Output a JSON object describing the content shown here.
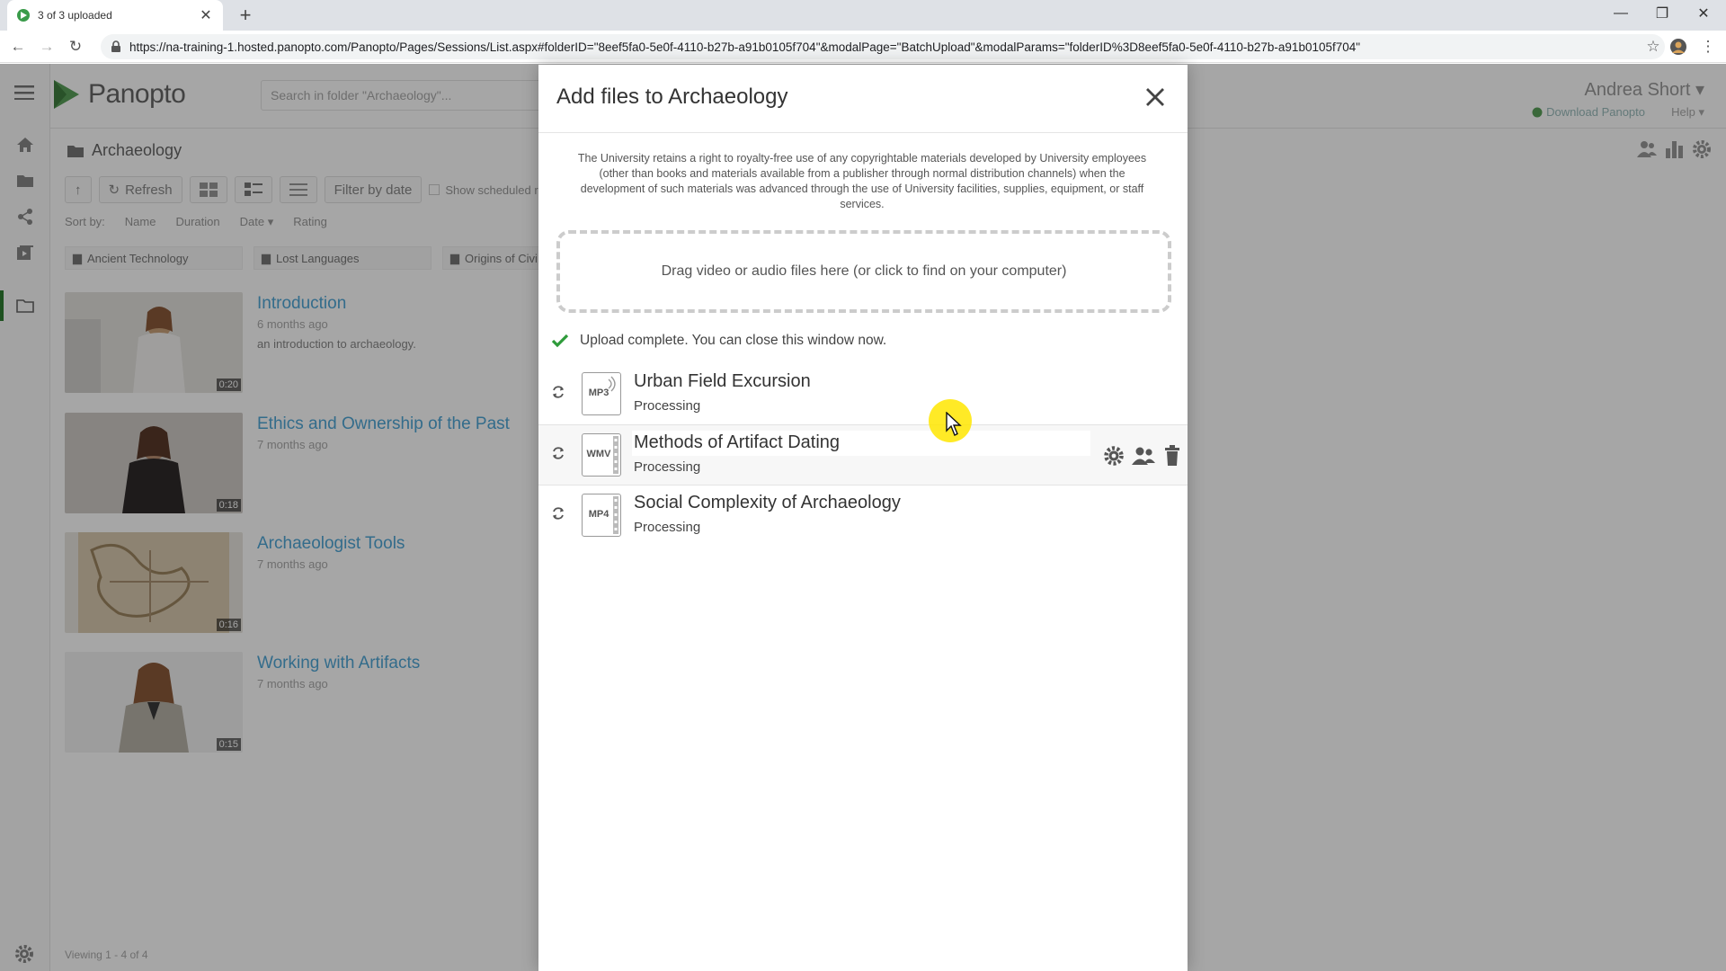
{
  "browser": {
    "tab_title": "3 of 3 uploaded",
    "url": "https://na-training-1.hosted.panopto.com/Panopto/Pages/Sessions/List.aspx#folderID=\"8eef5fa0-5e0f-4110-b27b-a91b0105f704\"&modalPage=\"BatchUpload\"&modalParams=\"folderID%3D8eef5fa0-5e0f-4110-b27b-a91b0105f704\""
  },
  "app": {
    "logo_text": "Panopto",
    "search_placeholder": "Search in folder \"Archaeology\"...",
    "user_name": "Andrea Short",
    "download_label": "Download Panopto",
    "help_label": "Help",
    "folder_title": "Archaeology",
    "toolbar": {
      "refresh": "Refresh",
      "filter": "Filter by date",
      "show_scheduled": "Show scheduled re"
    },
    "sort": {
      "label": "Sort by:",
      "name": "Name",
      "duration": "Duration",
      "date": "Date",
      "rating": "Rating"
    },
    "subfolders": [
      "Ancient Technology",
      "Lost Languages",
      "Origins of Civi"
    ],
    "sessions": [
      {
        "title": "Introduction",
        "date": "6 months ago",
        "desc": "an introduction to archaeology.",
        "duration": "0:20"
      },
      {
        "title": "Ethics and Ownership of the Past",
        "date": "7 months ago",
        "desc": "",
        "duration": "0:18"
      },
      {
        "title": "Archaeologist Tools",
        "date": "7 months ago",
        "desc": "",
        "duration": "0:16"
      },
      {
        "title": "Working with Artifacts",
        "date": "7 months ago",
        "desc": "",
        "duration": "0:15"
      }
    ],
    "viewing": "Viewing 1 - 4 of 4"
  },
  "modal": {
    "title": "Add files to Archaeology",
    "terms": "The University retains a right to royalty-free use of any copyrightable materials developed by University employees (other than books and materials available from a publisher through normal distribution channels) when the development of such materials was advanced through the use of University facilities, supplies, equipment, or staff services.",
    "drop_text": "Drag video or audio files here (or click to find on your computer)",
    "status": "Upload complete. You can close this window now.",
    "files": [
      {
        "ext": "MP3",
        "name": "Urban Field Excursion",
        "state": "Processing"
      },
      {
        "ext": "WMV",
        "name": "Methods of Artifact Dating",
        "state": "Processing"
      },
      {
        "ext": "MP4",
        "name": "Social Complexity of Archaeology",
        "state": "Processing"
      }
    ]
  },
  "colors": {
    "success": "#2e9b3a",
    "link": "#4fa6d6",
    "cursor_highlight": "#ffe600"
  }
}
